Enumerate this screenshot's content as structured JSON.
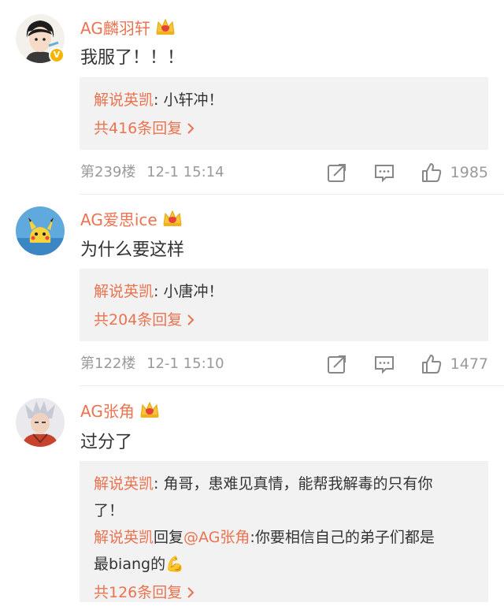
{
  "comments": [
    {
      "username": "AG麟羽轩",
      "text": "我服了！！！",
      "verified": true,
      "replies": [
        {
          "user": "解说英凯",
          "sep": ": ",
          "text": "小轩冲！"
        }
      ],
      "more_replies": "共416条回复",
      "floor": "第239楼",
      "time": "12-1 15:14",
      "likes": "1985"
    },
    {
      "username": "AG爱思ice",
      "text": "为什么要这样",
      "verified": false,
      "replies": [
        {
          "user": "解说英凯",
          "sep": ": ",
          "text": "小唐冲！"
        }
      ],
      "more_replies": "共204条回复",
      "floor": "第122楼",
      "time": "12-1 15:10",
      "likes": "1477"
    },
    {
      "username": "AG张角",
      "text": "过分了",
      "verified": false,
      "replies": [
        {
          "user": "解说英凯",
          "sep": ": ",
          "text_line1": "角哥，患难见真情，能帮我解毒的只有你",
          "text_line2": "了！"
        },
        {
          "user": "解说英凯",
          "reply_word": "回复",
          "mention": "@AG张角",
          "text_line1": ":你要相信自己的弟子们都是",
          "text_line2": "最biang的",
          "emoji": "💪"
        }
      ],
      "more_replies": "共126条回复"
    }
  ],
  "icons": {
    "badge": "crown-vip-badge",
    "verified": "v-verified-icon",
    "share": "share-icon",
    "comment": "comment-icon",
    "like": "thumbs-up-icon",
    "chevron": "chevron-right-icon"
  },
  "colors": {
    "username": "#eb7350",
    "link": "#eb7350",
    "meta": "#9a9a9a",
    "reply_bg": "#f2f2f2",
    "verified": "#f5b400"
  }
}
